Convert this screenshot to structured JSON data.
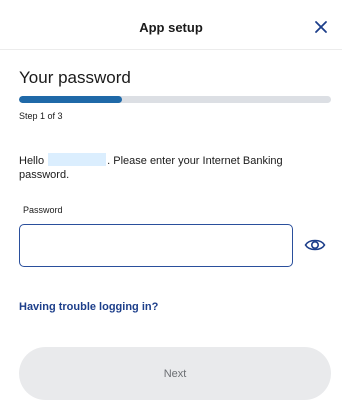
{
  "header": {
    "title": "App setup",
    "close_icon": "close-icon"
  },
  "page": {
    "title": "Your password",
    "progress": {
      "current_step": 1,
      "total_steps": 3,
      "fill_fraction": 0.33,
      "fill_color": "#1f69a8",
      "track_color": "#dcdfe4"
    },
    "step_label": "Step 1 of 3",
    "intro": {
      "greeting": "Hello",
      "message": ". Please enter your Internet Banking password."
    }
  },
  "form": {
    "password_label": "Password",
    "password_value": "",
    "show_password_icon": "eye-icon"
  },
  "links": {
    "trouble": "Having trouble logging in?"
  },
  "actions": {
    "next_label": "Next"
  },
  "colors": {
    "link": "#1c3e8a",
    "input_border": "#2a4f9c",
    "button_bg": "#e9eaec",
    "name_mask": "#dbeefe"
  }
}
